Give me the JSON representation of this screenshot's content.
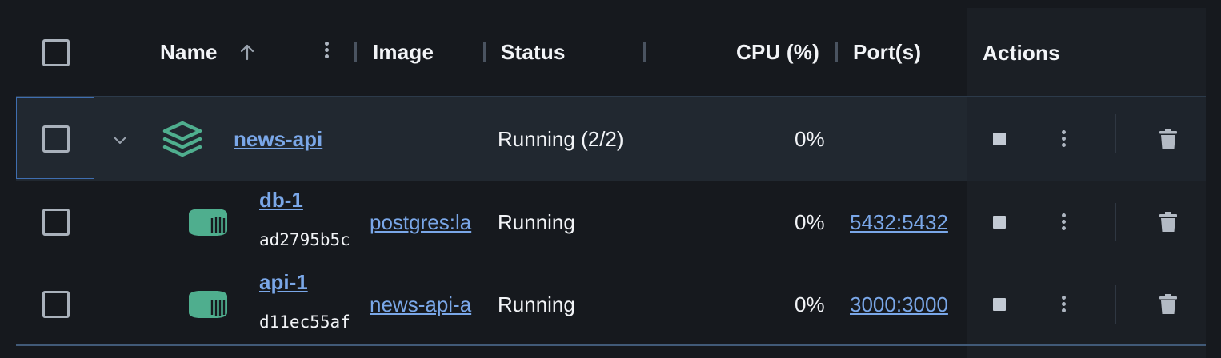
{
  "header": {
    "name": "Name",
    "image": "Image",
    "status": "Status",
    "cpu": "CPU (%)",
    "ports": "Port(s)",
    "actions": "Actions"
  },
  "group": {
    "name": "news-api",
    "status": "Running (2/2)",
    "cpu": "0%"
  },
  "containers": [
    {
      "name": "db-1",
      "id": "ad2795b5c",
      "image": "postgres:la",
      "status": "Running",
      "cpu": "0%",
      "ports": "5432:5432"
    },
    {
      "name": "api-1",
      "id": "d11ec55af",
      "image": "news-api-a",
      "status": "Running",
      "cpu": "0%",
      "ports": "3000:3000"
    }
  ],
  "colors": {
    "background": "#16191e",
    "link": "#7aa7e8",
    "accent_green": "#4fae8e",
    "selection_border": "#3f6eb0"
  },
  "icons": {
    "sort": "arrow-up-icon",
    "column_menu": "kebab-icon",
    "expand": "chevron-down-icon",
    "stack": "stack-icon",
    "container": "container-icon",
    "stop": "stop-icon",
    "more": "more-vertical-icon",
    "delete": "trash-icon"
  }
}
